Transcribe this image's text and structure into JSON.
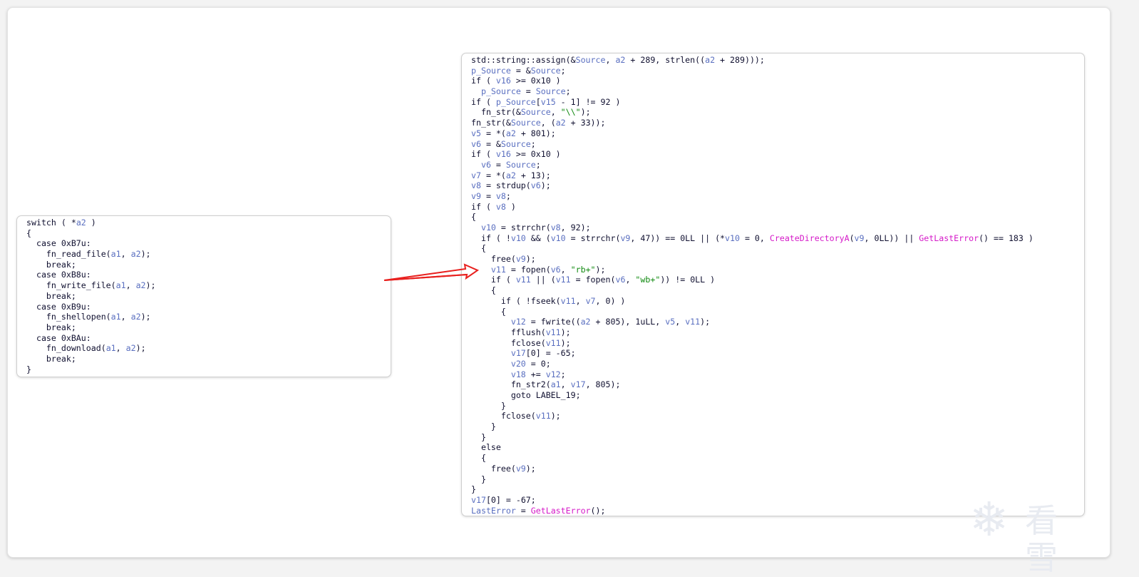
{
  "switch_panel": {
    "lines": [
      [
        {
          "t": "switch ( *"
        },
        {
          "t": "a2",
          "c": "v"
        },
        {
          "t": " )"
        }
      ],
      [
        {
          "t": "{"
        }
      ],
      [
        {
          "t": "  case 0xB7u:"
        }
      ],
      [
        {
          "t": "    fn_read_file("
        },
        {
          "t": "a1",
          "c": "v"
        },
        {
          "t": ", "
        },
        {
          "t": "a2",
          "c": "v"
        },
        {
          "t": ");"
        }
      ],
      [
        {
          "t": "    break;"
        }
      ],
      [
        {
          "t": "  case 0xB8u:"
        }
      ],
      [
        {
          "t": "    fn_write_file("
        },
        {
          "t": "a1",
          "c": "v"
        },
        {
          "t": ", "
        },
        {
          "t": "a2",
          "c": "v"
        },
        {
          "t": ");"
        }
      ],
      [
        {
          "t": "    break;"
        }
      ],
      [
        {
          "t": "  case 0xB9u:"
        }
      ],
      [
        {
          "t": "    fn_shellopen("
        },
        {
          "t": "a1",
          "c": "v"
        },
        {
          "t": ", "
        },
        {
          "t": "a2",
          "c": "v"
        },
        {
          "t": ");"
        }
      ],
      [
        {
          "t": "    break;"
        }
      ],
      [
        {
          "t": "  case 0xBAu:"
        }
      ],
      [
        {
          "t": "    fn_download("
        },
        {
          "t": "a1",
          "c": "v"
        },
        {
          "t": ", "
        },
        {
          "t": "a2",
          "c": "v"
        },
        {
          "t": ");"
        }
      ],
      [
        {
          "t": "    break;"
        }
      ],
      [
        {
          "t": "}"
        }
      ]
    ]
  },
  "main_panel": {
    "lines": [
      [
        {
          "t": "std::string::assign(&"
        },
        {
          "t": "Source",
          "c": "v"
        },
        {
          "t": ", "
        },
        {
          "t": "a2",
          "c": "v"
        },
        {
          "t": " + 289, strlen(("
        },
        {
          "t": "a2",
          "c": "v"
        },
        {
          "t": " + 289)));"
        }
      ],
      [
        {
          "t": "p_Source",
          "c": "v"
        },
        {
          "t": " = &"
        },
        {
          "t": "Source",
          "c": "v"
        },
        {
          "t": ";"
        }
      ],
      [
        {
          "t": "if ( "
        },
        {
          "t": "v16",
          "c": "v"
        },
        {
          "t": " >= 0x10 )"
        }
      ],
      [
        {
          "t": "  "
        },
        {
          "t": "p_Source",
          "c": "v"
        },
        {
          "t": " = "
        },
        {
          "t": "Source",
          "c": "v"
        },
        {
          "t": ";"
        }
      ],
      [
        {
          "t": "if ( "
        },
        {
          "t": "p_Source",
          "c": "v"
        },
        {
          "t": "["
        },
        {
          "t": "v15",
          "c": "v"
        },
        {
          "t": " - 1] != 92 )"
        }
      ],
      [
        {
          "t": "  fn_str(&"
        },
        {
          "t": "Source",
          "c": "v"
        },
        {
          "t": ", "
        },
        {
          "t": "\"\\\\\"",
          "c": "s"
        },
        {
          "t": ");"
        }
      ],
      [
        {
          "t": "fn_str(&"
        },
        {
          "t": "Source",
          "c": "v"
        },
        {
          "t": ", ("
        },
        {
          "t": "a2",
          "c": "v"
        },
        {
          "t": " + 33));"
        }
      ],
      [
        {
          "t": "v5",
          "c": "v"
        },
        {
          "t": " = *("
        },
        {
          "t": "a2",
          "c": "v"
        },
        {
          "t": " + 801);"
        }
      ],
      [
        {
          "t": "v6",
          "c": "v"
        },
        {
          "t": " = &"
        },
        {
          "t": "Source",
          "c": "v"
        },
        {
          "t": ";"
        }
      ],
      [
        {
          "t": "if ( "
        },
        {
          "t": "v16",
          "c": "v"
        },
        {
          "t": " >= 0x10 )"
        }
      ],
      [
        {
          "t": "  "
        },
        {
          "t": "v6",
          "c": "v"
        },
        {
          "t": " = "
        },
        {
          "t": "Source",
          "c": "v"
        },
        {
          "t": ";"
        }
      ],
      [
        {
          "t": "v7",
          "c": "v"
        },
        {
          "t": " = *("
        },
        {
          "t": "a2",
          "c": "v"
        },
        {
          "t": " + 13);"
        }
      ],
      [
        {
          "t": "v8",
          "c": "v"
        },
        {
          "t": " = strdup("
        },
        {
          "t": "v6",
          "c": "v"
        },
        {
          "t": ");"
        }
      ],
      [
        {
          "t": "v9",
          "c": "v"
        },
        {
          "t": " = "
        },
        {
          "t": "v8",
          "c": "v"
        },
        {
          "t": ";"
        }
      ],
      [
        {
          "t": "if ( "
        },
        {
          "t": "v8",
          "c": "v"
        },
        {
          "t": " )"
        }
      ],
      [
        {
          "t": "{"
        }
      ],
      [
        {
          "t": "  "
        },
        {
          "t": "v10",
          "c": "v"
        },
        {
          "t": " = strrchr("
        },
        {
          "t": "v8",
          "c": "v"
        },
        {
          "t": ", 92);"
        }
      ],
      [
        {
          "t": "  if ( !"
        },
        {
          "t": "v10",
          "c": "v"
        },
        {
          "t": " && ("
        },
        {
          "t": "v10",
          "c": "v"
        },
        {
          "t": " = strrchr("
        },
        {
          "t": "v9",
          "c": "v"
        },
        {
          "t": ", 47)) == 0LL || (*"
        },
        {
          "t": "v10",
          "c": "v"
        },
        {
          "t": " = 0, "
        },
        {
          "t": "CreateDirectoryA",
          "c": "m"
        },
        {
          "t": "("
        },
        {
          "t": "v9",
          "c": "v"
        },
        {
          "t": ", 0LL)) || "
        },
        {
          "t": "GetLastError",
          "c": "m"
        },
        {
          "t": "() == 183 )"
        }
      ],
      [
        {
          "t": "  {"
        }
      ],
      [
        {
          "t": "    free("
        },
        {
          "t": "v9",
          "c": "v"
        },
        {
          "t": ");"
        }
      ],
      [
        {
          "t": "    "
        },
        {
          "t": "v11",
          "c": "v"
        },
        {
          "t": " = fopen("
        },
        {
          "t": "v6",
          "c": "v"
        },
        {
          "t": ", "
        },
        {
          "t": "\"rb+\"",
          "c": "s"
        },
        {
          "t": ");"
        }
      ],
      [
        {
          "t": "    if ( "
        },
        {
          "t": "v11",
          "c": "v"
        },
        {
          "t": " || ("
        },
        {
          "t": "v11",
          "c": "v"
        },
        {
          "t": " = fopen("
        },
        {
          "t": "v6",
          "c": "v"
        },
        {
          "t": ", "
        },
        {
          "t": "\"wb+\"",
          "c": "s"
        },
        {
          "t": ")) != 0LL )"
        }
      ],
      [
        {
          "t": "    {"
        }
      ],
      [
        {
          "t": "      if ( !fseek("
        },
        {
          "t": "v11",
          "c": "v"
        },
        {
          "t": ", "
        },
        {
          "t": "v7",
          "c": "v"
        },
        {
          "t": ", 0) )"
        }
      ],
      [
        {
          "t": "      {"
        }
      ],
      [
        {
          "t": "        "
        },
        {
          "t": "v12",
          "c": "v"
        },
        {
          "t": " = fwrite(("
        },
        {
          "t": "a2",
          "c": "v"
        },
        {
          "t": " + 805), 1uLL, "
        },
        {
          "t": "v5",
          "c": "v"
        },
        {
          "t": ", "
        },
        {
          "t": "v11",
          "c": "v"
        },
        {
          "t": ");"
        }
      ],
      [
        {
          "t": "        fflush("
        },
        {
          "t": "v11",
          "c": "v"
        },
        {
          "t": ");"
        }
      ],
      [
        {
          "t": "        fclose("
        },
        {
          "t": "v11",
          "c": "v"
        },
        {
          "t": ");"
        }
      ],
      [
        {
          "t": "        "
        },
        {
          "t": "v17",
          "c": "v"
        },
        {
          "t": "[0] = -65;"
        }
      ],
      [
        {
          "t": "        "
        },
        {
          "t": "v20",
          "c": "v"
        },
        {
          "t": " = 0;"
        }
      ],
      [
        {
          "t": "        "
        },
        {
          "t": "v18",
          "c": "v"
        },
        {
          "t": " += "
        },
        {
          "t": "v12",
          "c": "v"
        },
        {
          "t": ";"
        }
      ],
      [
        {
          "t": "        fn_str2("
        },
        {
          "t": "a1",
          "c": "v"
        },
        {
          "t": ", "
        },
        {
          "t": "v17",
          "c": "v"
        },
        {
          "t": ", 805);"
        }
      ],
      [
        {
          "t": "        goto LABEL_19;"
        }
      ],
      [
        {
          "t": "      }"
        }
      ],
      [
        {
          "t": "      fclose("
        },
        {
          "t": "v11",
          "c": "v"
        },
        {
          "t": ");"
        }
      ],
      [
        {
          "t": "    }"
        }
      ],
      [
        {
          "t": "  }"
        }
      ],
      [
        {
          "t": "  else"
        }
      ],
      [
        {
          "t": "  {"
        }
      ],
      [
        {
          "t": "    free("
        },
        {
          "t": "v9",
          "c": "v"
        },
        {
          "t": ");"
        }
      ],
      [
        {
          "t": "  }"
        }
      ],
      [
        {
          "t": "}"
        }
      ],
      [
        {
          "t": "v17",
          "c": "v"
        },
        {
          "t": "[0] = -67;"
        }
      ],
      [
        {
          "t": "LastError",
          "c": "v"
        },
        {
          "t": " = "
        },
        {
          "t": "GetLastError",
          "c": "m"
        },
        {
          "t": "();"
        }
      ]
    ]
  },
  "arrow": {
    "color": "#e8201e",
    "icon": "arrow-right-icon"
  },
  "watermark": {
    "icon": "snowflake-icon",
    "text": "看雪"
  }
}
